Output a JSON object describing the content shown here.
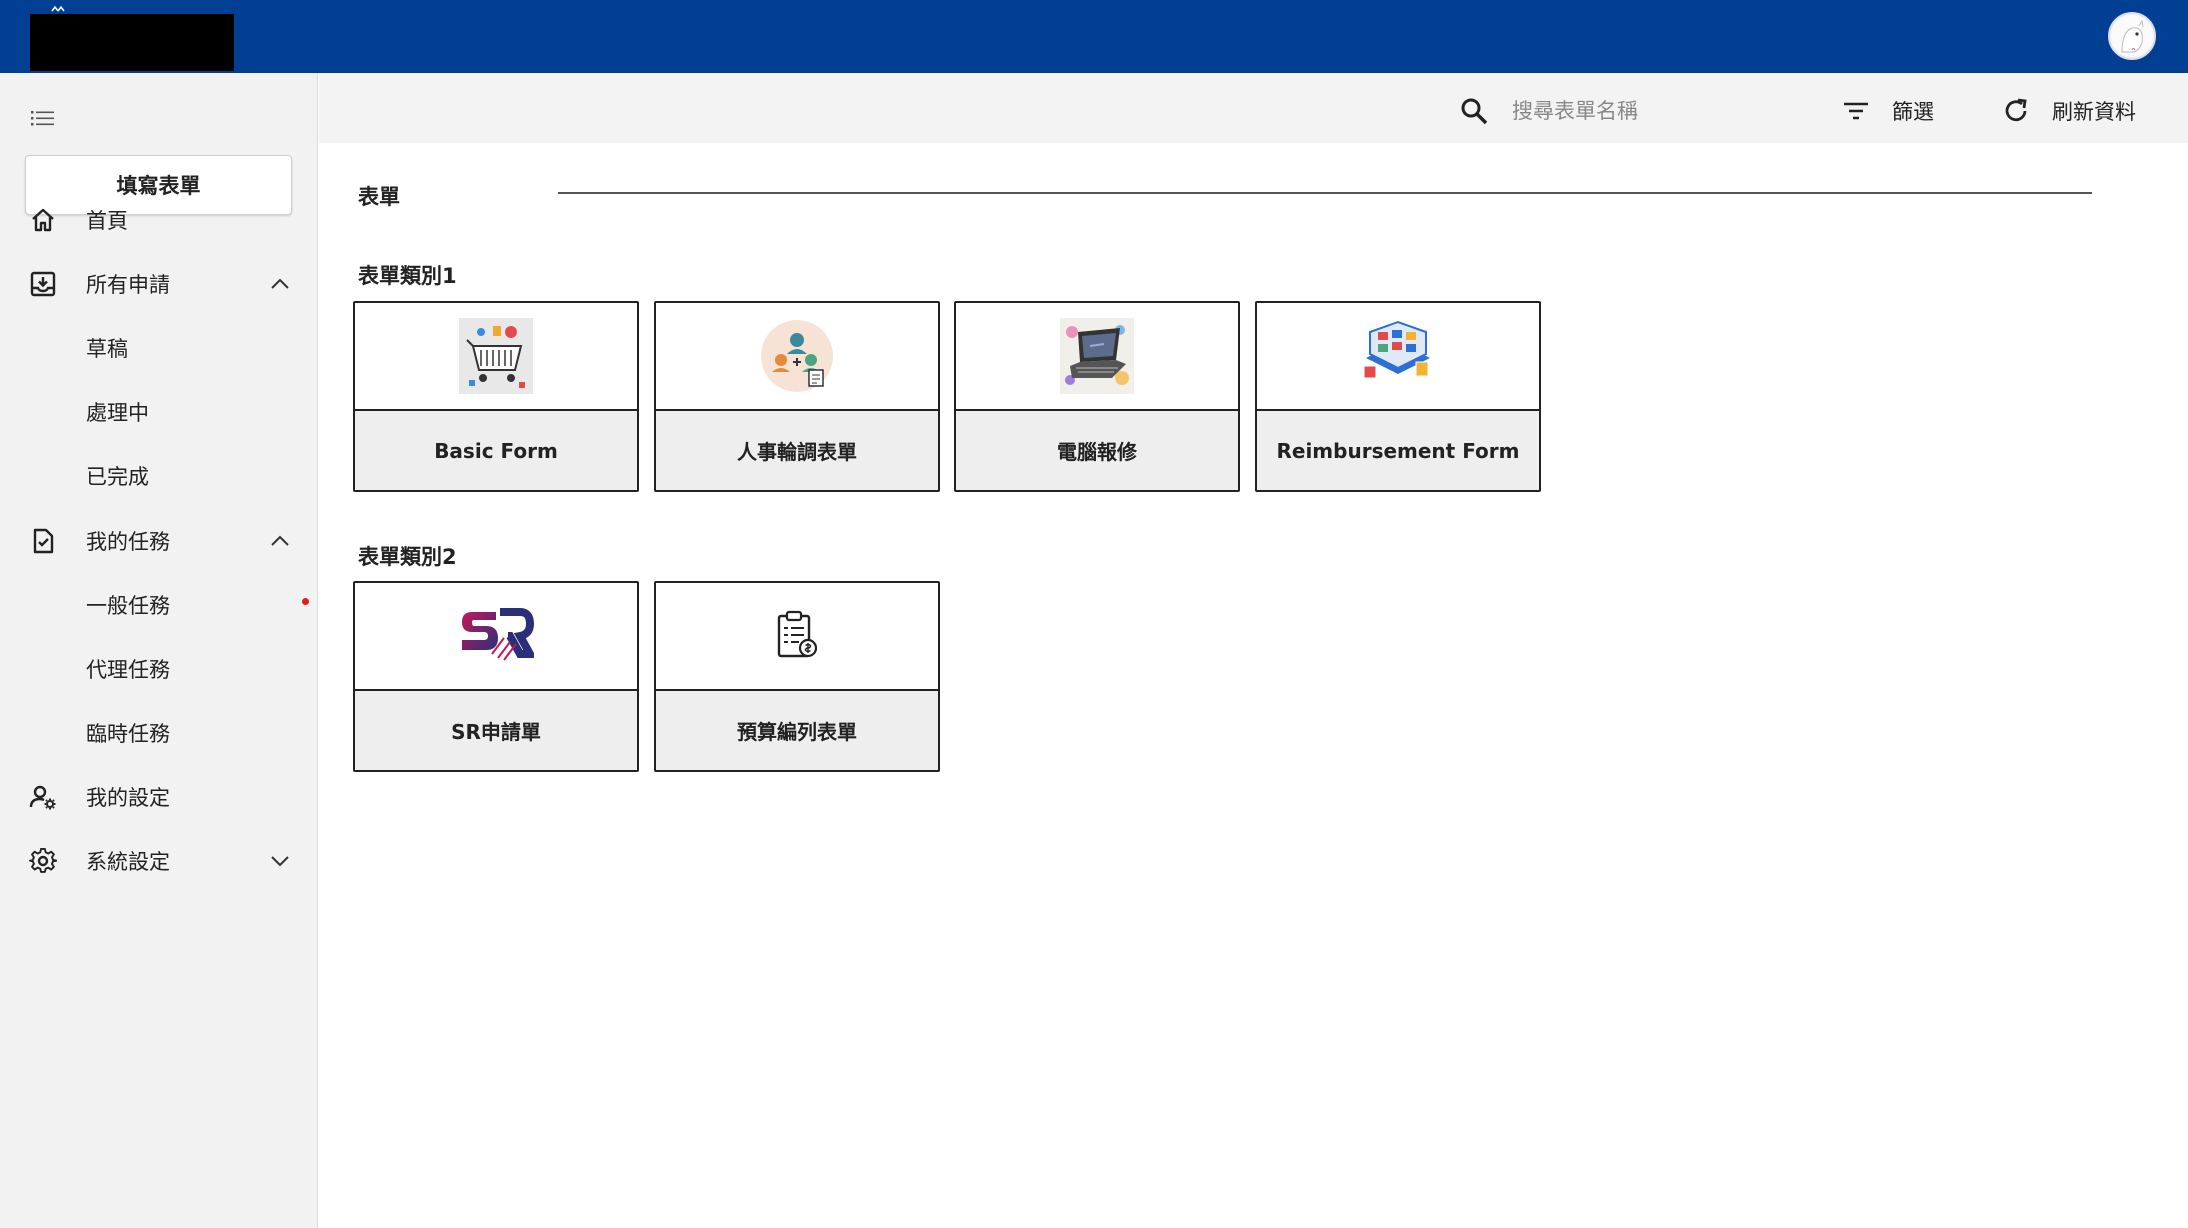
{
  "app": {
    "accent": "#003f91",
    "avatar_icon": "user-avatar"
  },
  "sidebar": {
    "fill_button_label": "填寫表單",
    "items": [
      {
        "label": "首頁",
        "icon": "home-icon"
      },
      {
        "label": "所有申請",
        "icon": "inbox-download-icon",
        "expanded": true
      },
      {
        "label": "草稿"
      },
      {
        "label": "處理中"
      },
      {
        "label": "已完成"
      },
      {
        "label": "我的任務",
        "icon": "task-check-icon",
        "expanded": true
      },
      {
        "label": "一般任務",
        "badge_color": "#e31d1d"
      },
      {
        "label": "代理任務"
      },
      {
        "label": "臨時任務"
      },
      {
        "label": "我的設定",
        "icon": "user-settings-icon"
      },
      {
        "label": "系統設定",
        "icon": "gear-icon",
        "expanded": false
      }
    ]
  },
  "toolbar": {
    "search_placeholder": "搜尋表單名稱",
    "filter_label": "篩選",
    "refresh_label": "刷新資料"
  },
  "main": {
    "section_title": "表單",
    "categories": [
      {
        "title": "表單類別1",
        "forms": [
          {
            "label": "Basic Form",
            "icon": "shopping-cart-icon"
          },
          {
            "label": "人事輪調表單",
            "icon": "people-rotation-icon"
          },
          {
            "label": "電腦報修",
            "icon": "laptop-repair-icon"
          },
          {
            "label": "Reimbursement Form",
            "icon": "calendar-dashboard-icon"
          }
        ]
      },
      {
        "title": "表單類別2",
        "forms": [
          {
            "label": "SR申請單",
            "icon": "sr-logo-icon"
          },
          {
            "label": "預算編列表單",
            "icon": "clipboard-budget-icon"
          }
        ]
      }
    ]
  }
}
